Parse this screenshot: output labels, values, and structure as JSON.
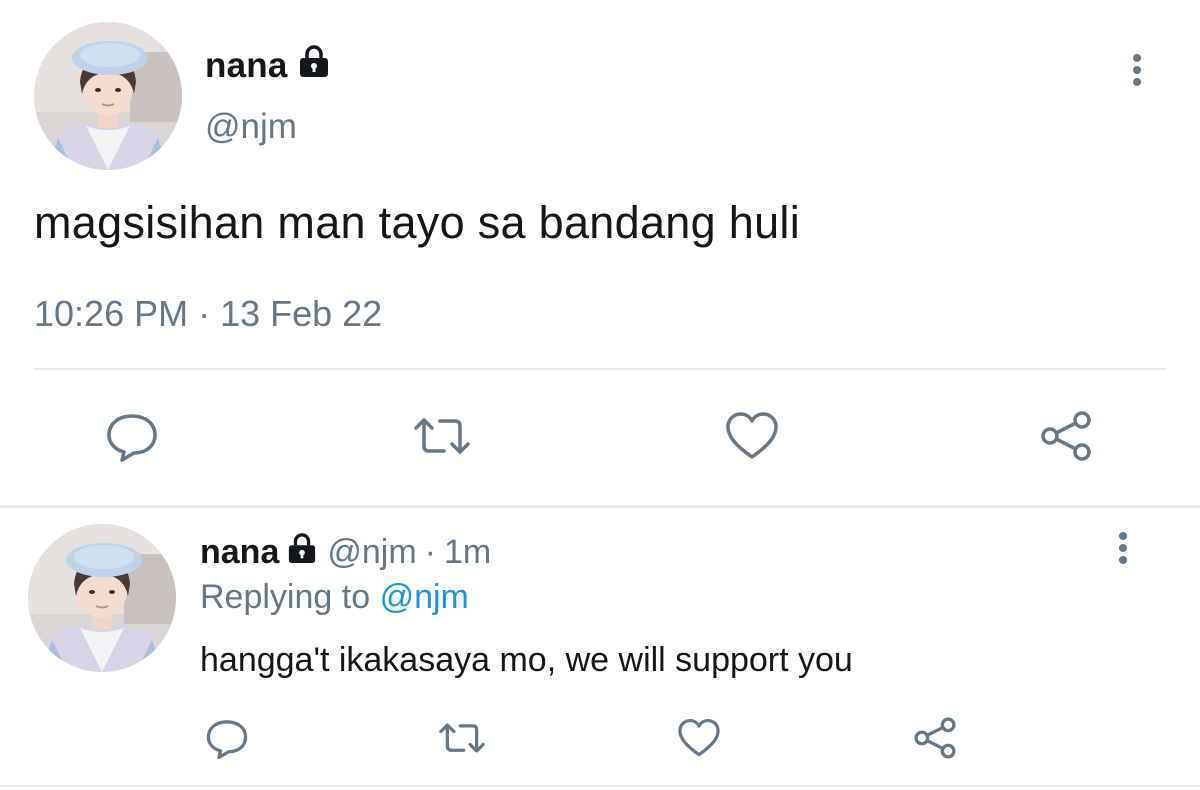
{
  "main_tweet": {
    "author_name": "nana",
    "author_handle": "@njm",
    "text": "magsisihan man tayo sa bandang huli",
    "timestamp": "10:26 PM · 13 Feb 22",
    "icons": [
      "lock-icon",
      "more-vertical-icon",
      "reply-icon",
      "retweet-icon",
      "like-icon",
      "share-icon"
    ]
  },
  "reply_tweet": {
    "author_name": "nana",
    "author_handle": "@njm",
    "separator": "·",
    "age": "1m",
    "replying_label": "Replying to",
    "replying_handle": "@njm",
    "text": "hangga't ikakasaya mo, we will support you"
  },
  "colors": {
    "text_primary": "#14171a",
    "text_muted": "#657786",
    "icon": "#657786",
    "link": "#1b95e0",
    "divider": "#e6ecf0"
  }
}
